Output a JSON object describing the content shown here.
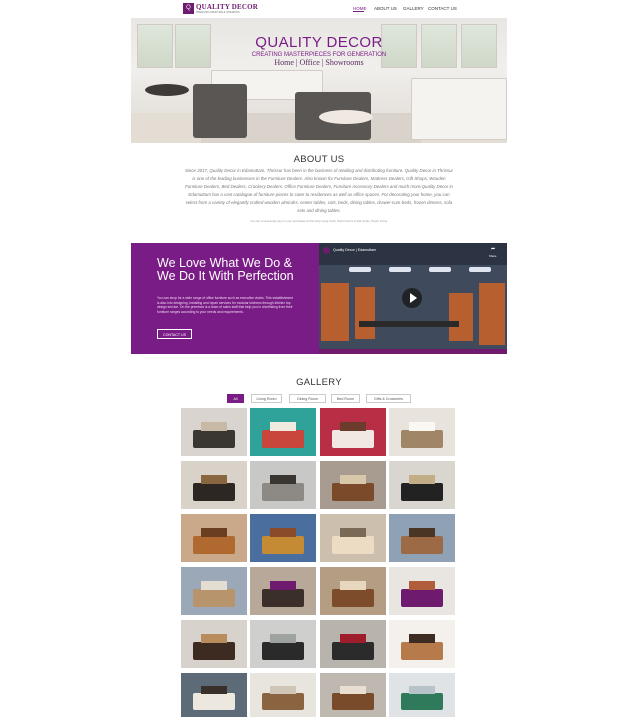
{
  "brand": {
    "logo_glyph": "Q",
    "name": "QUALITY DECOR",
    "tagline": "PREMIUM FURNITURE & INTERIORS"
  },
  "nav": [
    {
      "label": "HOME",
      "active": true
    },
    {
      "label": "ABOUT US",
      "active": false
    },
    {
      "label": "GALLERY",
      "active": false
    },
    {
      "label": "CONTACT US",
      "active": false
    }
  ],
  "hero": {
    "title": "QUALITY DECOR",
    "tagline": "CREATING MASTERPIECES FOR GENERATION",
    "subtitle": "Home | Office | Showrooms"
  },
  "about": {
    "heading": "ABOUT US",
    "text": "Since 2017, Quality Decor in Edamuttam, Thrissur has been in the business of retailing and distributing furniture. Quality Decor in Thrissur is one of the leading businesses in the Furniture Dealers. Also known for Furniture Dealers, Mattress Dealers, Gift Shops, Wooden Furniture Dealers, Bed Dealers, Crockery Dealers, Office Furniture Dealers, Furniture Accessory Dealers and much more.Quality Decor in Edamuttam has a vast catalogue of furniture pieces to cater to residences as well as office spaces. For decorating your home, you can select from a variety of elegantly crafted wooden almirahs, center tables, cots, beds, dining tables, drawer-cum-beds, frozen dinners, sofa sets and dining tables.",
    "note": "You can conveniently pay for your purchases at this shop using Cash, Debit Card & Credit Cards, Paytm & Pay."
  },
  "promo": {
    "heading": "We Love What We Do & We Do It With Perfection",
    "text": "You can shop for a wide range of office furniture such as executive chairs. This establishment is also into designing, installing and repair services for modular kitchens through kitchen top design service. On the premises is a team of sales staff that help you in shortlisting from their furniture ranges according to your needs and requirements.",
    "button": "CONTACT US"
  },
  "video": {
    "title": "Quality Decor | Edamuttam",
    "share_icon": "➦",
    "share_label": "Share"
  },
  "gallery": {
    "heading": "GALLERY",
    "tabs": [
      {
        "label": "All",
        "active": true
      },
      {
        "label": "Living Room",
        "active": false
      },
      {
        "label": "Dining Room",
        "active": false
      },
      {
        "label": "Bed Room",
        "active": false
      },
      {
        "label": "Gifts & Crockeries",
        "active": false
      }
    ],
    "thumbs": [
      {
        "name": "bedroom-set",
        "bg": "#d9d4cf",
        "c1": "#3a3632",
        "c2": "#c8b9a6"
      },
      {
        "name": "kids-bedroom",
        "bg": "#2fa39a",
        "c1": "#c9463d",
        "c2": "#f0eae0"
      },
      {
        "name": "red-bedroom",
        "bg": "#b82f45",
        "c1": "#f1e8e4",
        "c2": "#6b3b2c"
      },
      {
        "name": "wardrobe-bed",
        "bg": "#e8e3dc",
        "c1": "#a08567",
        "c2": "#fbf8f3"
      },
      {
        "name": "dining-table-wood",
        "bg": "#d8d2c9",
        "c1": "#2c2723",
        "c2": "#8a6640"
      },
      {
        "name": "corner-sofa",
        "bg": "#c8c8c6",
        "c1": "#8d8a86",
        "c2": "#3a3632"
      },
      {
        "name": "wooden-sofa",
        "bg": "#a89c90",
        "c1": "#7b4a2a",
        "c2": "#d9c7a9"
      },
      {
        "name": "black-sofa-set",
        "bg": "#d9d6d0",
        "c1": "#222222",
        "c2": "#c2ad86"
      },
      {
        "name": "teak-chairs",
        "bg": "#caa88a",
        "c1": "#b0692e",
        "c2": "#6a3e1f"
      },
      {
        "name": "mustard-sofa",
        "bg": "#4a6f9e",
        "c1": "#c48a34",
        "c2": "#8a4b2a"
      },
      {
        "name": "cream-sofa",
        "bg": "#cdbfae",
        "c1": "#ebdcc3",
        "c2": "#7a6a55"
      },
      {
        "name": "brown-sofa-set",
        "bg": "#8fa1b5",
        "c1": "#9c6a44",
        "c2": "#4a3424"
      },
      {
        "name": "showroom-sofas",
        "bg": "#9aa8b8",
        "c1": "#b8946c",
        "c2": "#e4ddd2"
      },
      {
        "name": "egg-chair",
        "bg": "#b7a89a",
        "c1": "#3b2f2a",
        "c2": "#6d1a6f"
      },
      {
        "name": "showroom-wood",
        "bg": "#b59d83",
        "c1": "#7c4c2b",
        "c2": "#e8d7bf"
      },
      {
        "name": "logo-sofa",
        "bg": "#e9e6e2",
        "c1": "#6d1a6f",
        "c2": "#b05d3c"
      },
      {
        "name": "dining-chairs",
        "bg": "#d7d2cb",
        "c1": "#3d2a20",
        "c2": "#b88c5c"
      },
      {
        "name": "glass-table",
        "bg": "#cfd0cd",
        "c1": "#2a2a2a",
        "c2": "#9ea3a0"
      },
      {
        "name": "modern-dining",
        "bg": "#b9b3ae",
        "c1": "#2b2b2b",
        "c2": "#9d1d2a"
      },
      {
        "name": "decor-statues",
        "bg": "#f4f1ec",
        "c1": "#b77a4a",
        "c2": "#3e2c22"
      },
      {
        "name": "vase",
        "bg": "#5d6b78",
        "c1": "#ece8e0",
        "c2": "#3a302a"
      },
      {
        "name": "crockery-vase",
        "bg": "#e8e4de",
        "c1": "#8a6440",
        "c2": "#cfc6b8"
      },
      {
        "name": "wooden-tray",
        "bg": "#bfb8b0",
        "c1": "#7a4b2a",
        "c2": "#e8dfd2"
      },
      {
        "name": "crockery-set",
        "bg": "#dfe3e6",
        "c1": "#2f7a5a",
        "c2": "#b8c2c9"
      }
    ]
  }
}
